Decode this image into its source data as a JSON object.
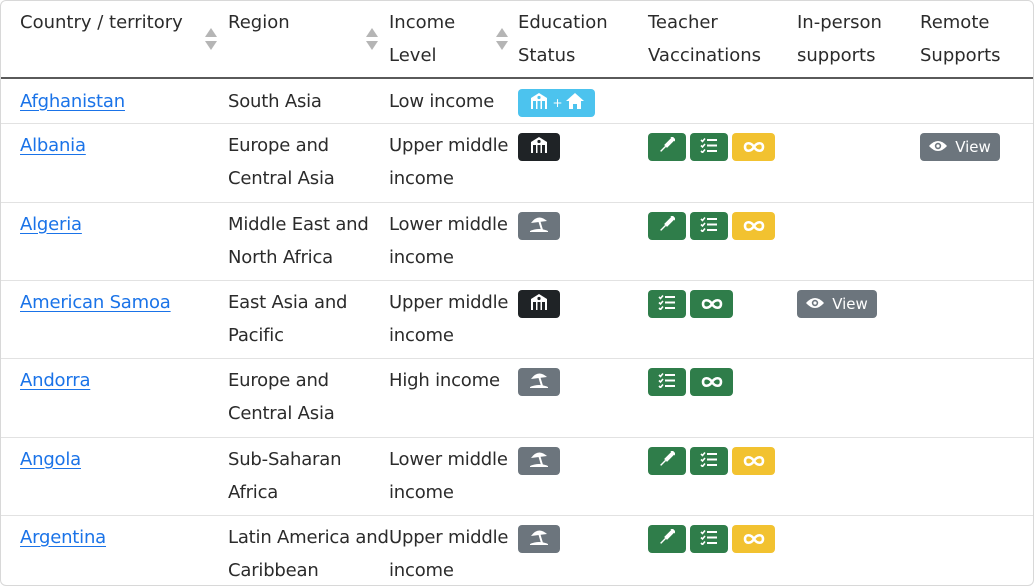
{
  "columns": [
    {
      "line1": "",
      "line2": "Country / territory"
    },
    {
      "line1": "",
      "line2": "Region"
    },
    {
      "line1": "Income",
      "line2": "Level"
    },
    {
      "line1": "Education",
      "line2": "Status"
    },
    {
      "line1": "Teacher",
      "line2": "Vaccinations"
    },
    {
      "line1": "In-person",
      "line2": "supports"
    },
    {
      "line1": "Remote",
      "line2": "Supports"
    }
  ],
  "rows": [
    {
      "country": "Afghanistan",
      "region": [
        "South Asia",
        ""
      ],
      "income": [
        "Low income",
        ""
      ],
      "education": "school-plus-home",
      "vaccinations": [],
      "in_person": "",
      "remote": ""
    },
    {
      "country": "Albania",
      "region": [
        "Europe and",
        "Central Asia"
      ],
      "income": [
        "Upper middle",
        "income"
      ],
      "education": "school",
      "vaccinations": [
        "syringe",
        "checklist",
        "infinity"
      ],
      "in_person": "",
      "remote": "View"
    },
    {
      "country": "Algeria",
      "region": [
        "Middle East and",
        "North Africa"
      ],
      "income": [
        "Lower middle",
        "income"
      ],
      "education": "beach",
      "vaccinations": [
        "syringe",
        "checklist",
        "infinity"
      ],
      "in_person": "",
      "remote": ""
    },
    {
      "country": "American Samoa",
      "region": [
        "East Asia and",
        "Pacific"
      ],
      "income": [
        "Upper middle",
        "income"
      ],
      "education": "school",
      "vaccinations": [
        "checklist",
        "infinity"
      ],
      "in_person": "View",
      "remote": ""
    },
    {
      "country": "Andorra",
      "region": [
        "Europe and",
        "Central Asia"
      ],
      "income": [
        "High income",
        ""
      ],
      "education": "beach",
      "vaccinations": [
        "checklist",
        "infinity"
      ],
      "in_person": "",
      "remote": ""
    },
    {
      "country": "Angola",
      "region": [
        "Sub-Saharan",
        "Africa"
      ],
      "income": [
        "Lower middle",
        "income"
      ],
      "education": "beach",
      "vaccinations": [
        "syringe",
        "checklist",
        "infinity"
      ],
      "in_person": "",
      "remote": ""
    },
    {
      "country": "Argentina",
      "region": [
        "Latin America and",
        "Caribbean"
      ],
      "income": [
        "Upper middle",
        "income"
      ],
      "education": "beach",
      "vaccinations": [
        "syringe",
        "checklist",
        "infinity"
      ],
      "in_person": "",
      "remote": ""
    }
  ],
  "colors": {
    "link": "#1a73e8",
    "badge_dark": "#1f2326",
    "badge_gray": "#6c757d",
    "badge_blue": "#4cc3ee",
    "badge_green": "#2f7d4a",
    "badge_yellow": "#f2c230"
  }
}
